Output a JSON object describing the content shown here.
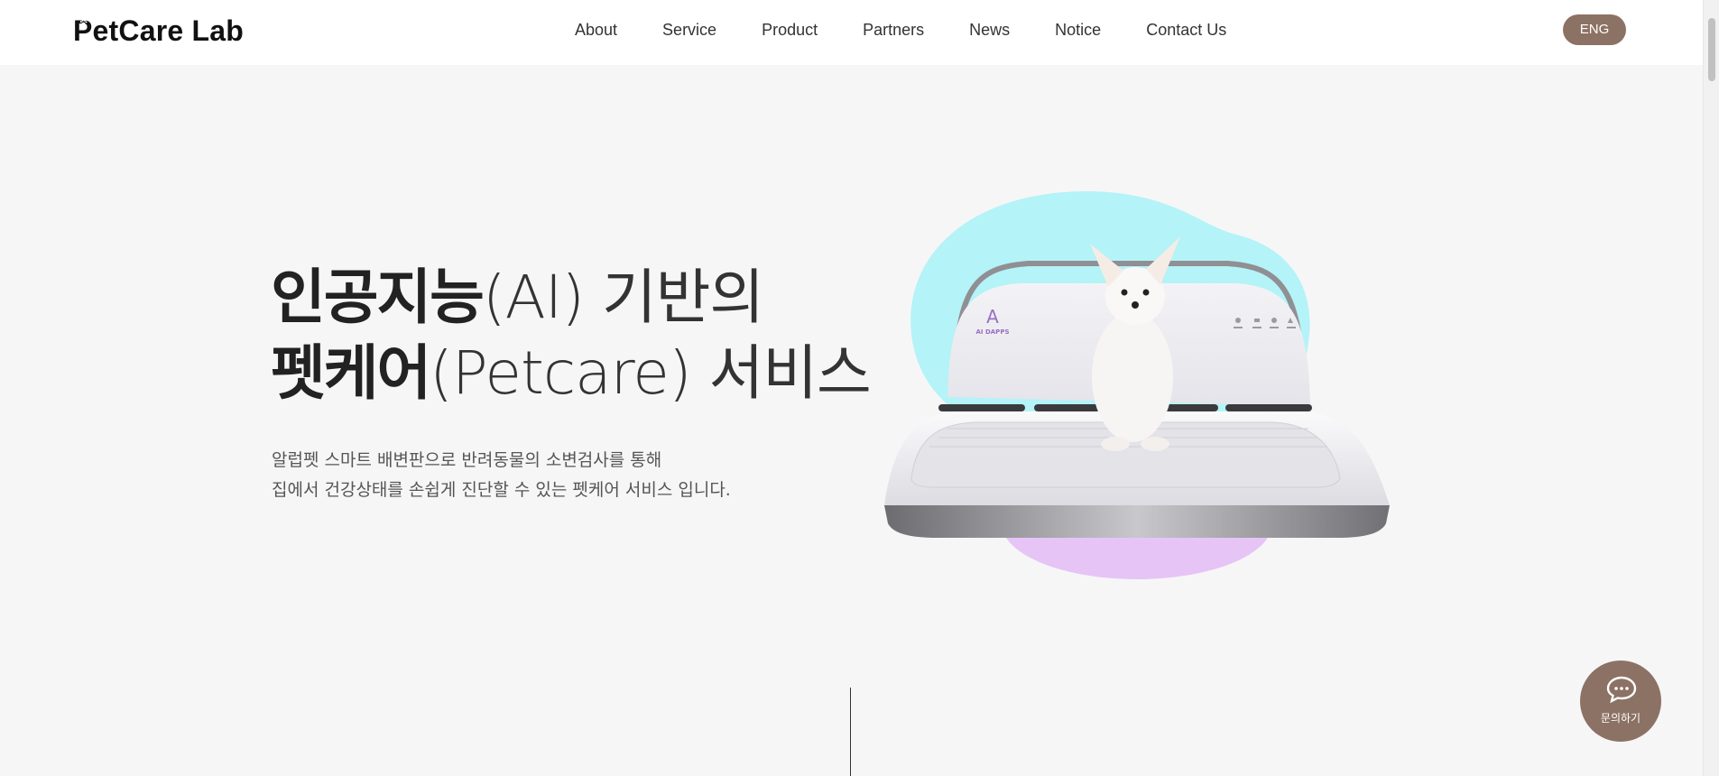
{
  "header": {
    "logo": {
      "first_letter": "P",
      "rest": "etCare Lab"
    },
    "nav": [
      "About",
      "Service",
      "Product",
      "Partners",
      "News",
      "Notice",
      "Contact Us"
    ],
    "lang_button": "ENG"
  },
  "hero": {
    "line1_bold": "인공지능",
    "line1_light": "(AI) 기반의",
    "line2_bold": "펫케어",
    "line2_light": "(Petcare) 서비스",
    "desc_line1": "알럽펫 스마트 배변판으로 반려동물의 소변검사를 통해",
    "desc_line2": "집에서 건강상태를 손쉽게 진단할 수 있는 펫케어 서비스 입니다."
  },
  "product_image": {
    "brand": "AI DAPPS",
    "icon": "pet-toilet-with-dog-image"
  },
  "inquiry_button": {
    "label": "문의하기",
    "icon": "chat-bubble-icon"
  },
  "colors": {
    "accent": "#8c7264",
    "blob_top": "#b3f3f8",
    "blob_bottom": "#e8c6f7",
    "background": "#f6f6f7"
  }
}
